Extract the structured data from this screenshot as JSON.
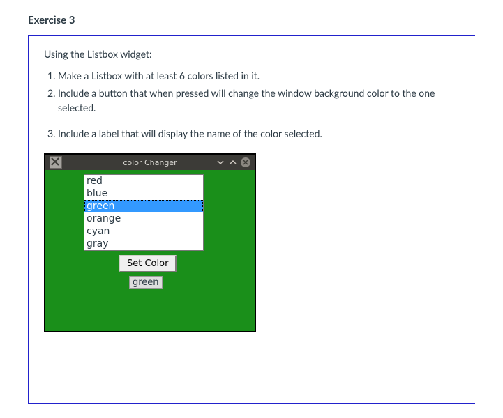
{
  "exercise": {
    "title": "Exercise 3",
    "intro": "Using the Listbox widget:",
    "steps": [
      "Make a Listbox with at least 6 colors listed in it.",
      "Include a button that when pressed will change the window background color to the one selected.",
      "Include a label that will display the name of the color selected."
    ]
  },
  "tk": {
    "title": "color Changer",
    "bg_color": "#1a8f1a",
    "listbox": {
      "items": [
        "red",
        "blue",
        "green",
        "orange",
        "cyan",
        "gray"
      ],
      "selected_index": 2
    },
    "button_label": "Set Color",
    "label_text": "green"
  }
}
